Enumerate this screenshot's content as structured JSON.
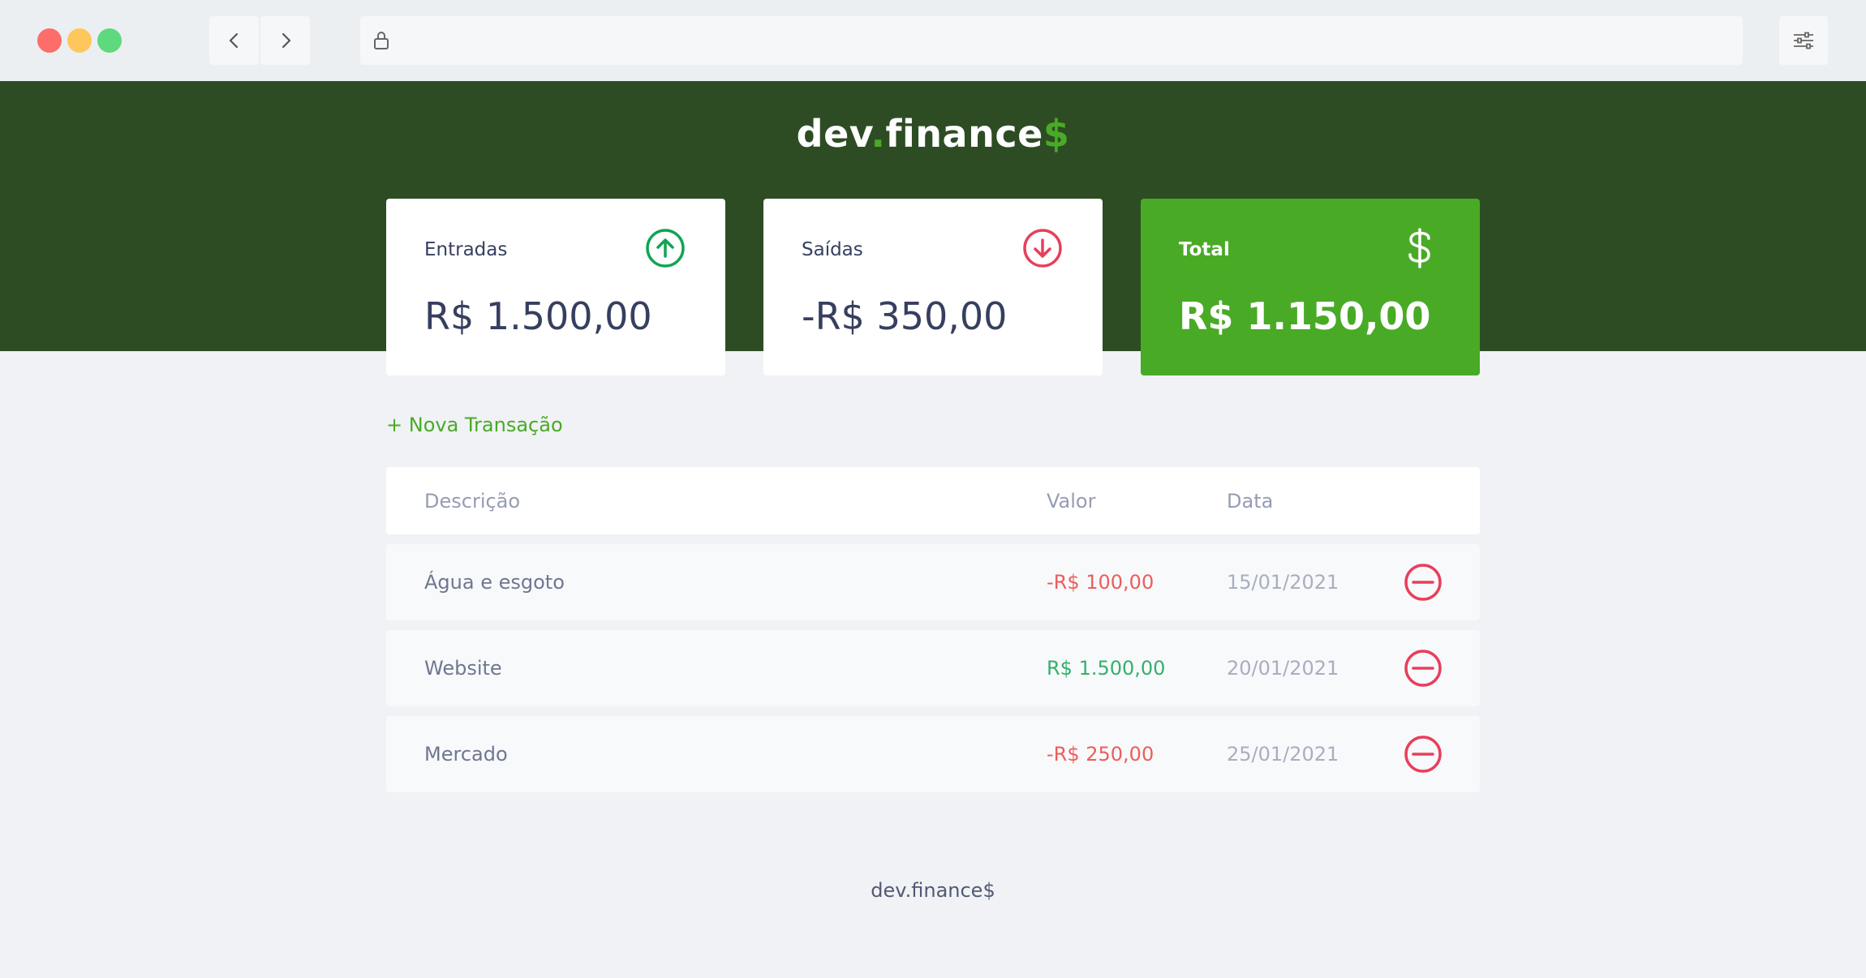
{
  "app": {
    "logo_main": "dev",
    "logo_dot": ".",
    "logo_rest": "finance",
    "logo_symbol": "$"
  },
  "cards": {
    "income": {
      "label": "Entradas",
      "value": "R$ 1.500,00",
      "icon": "arrow-up-circle-icon"
    },
    "expense": {
      "label": "Saídas",
      "value": "-R$ 350,00",
      "icon": "arrow-down-circle-icon"
    },
    "total": {
      "label": "Total",
      "value": "R$ 1.150,00",
      "icon": "dollar-icon"
    }
  },
  "actions": {
    "new_transaction": "+ Nova Transação"
  },
  "table": {
    "headers": {
      "description": "Descrição",
      "amount": "Valor",
      "date": "Data"
    },
    "rows": [
      {
        "description": "Água e esgoto",
        "amount": "-R$ 100,00",
        "date": "15/01/2021",
        "type": "expense"
      },
      {
        "description": "Website",
        "amount": "R$ 1.500,00",
        "date": "20/01/2021",
        "type": "income"
      },
      {
        "description": "Mercado",
        "amount": "-R$ 250,00",
        "date": "25/01/2021",
        "type": "expense"
      }
    ]
  },
  "footer": {
    "text": "dev.finance$"
  },
  "colors": {
    "header_bg": "#2e4c24",
    "brand_green": "#49aa26",
    "income_green": "#12a454",
    "expense_red": "#e92929"
  }
}
